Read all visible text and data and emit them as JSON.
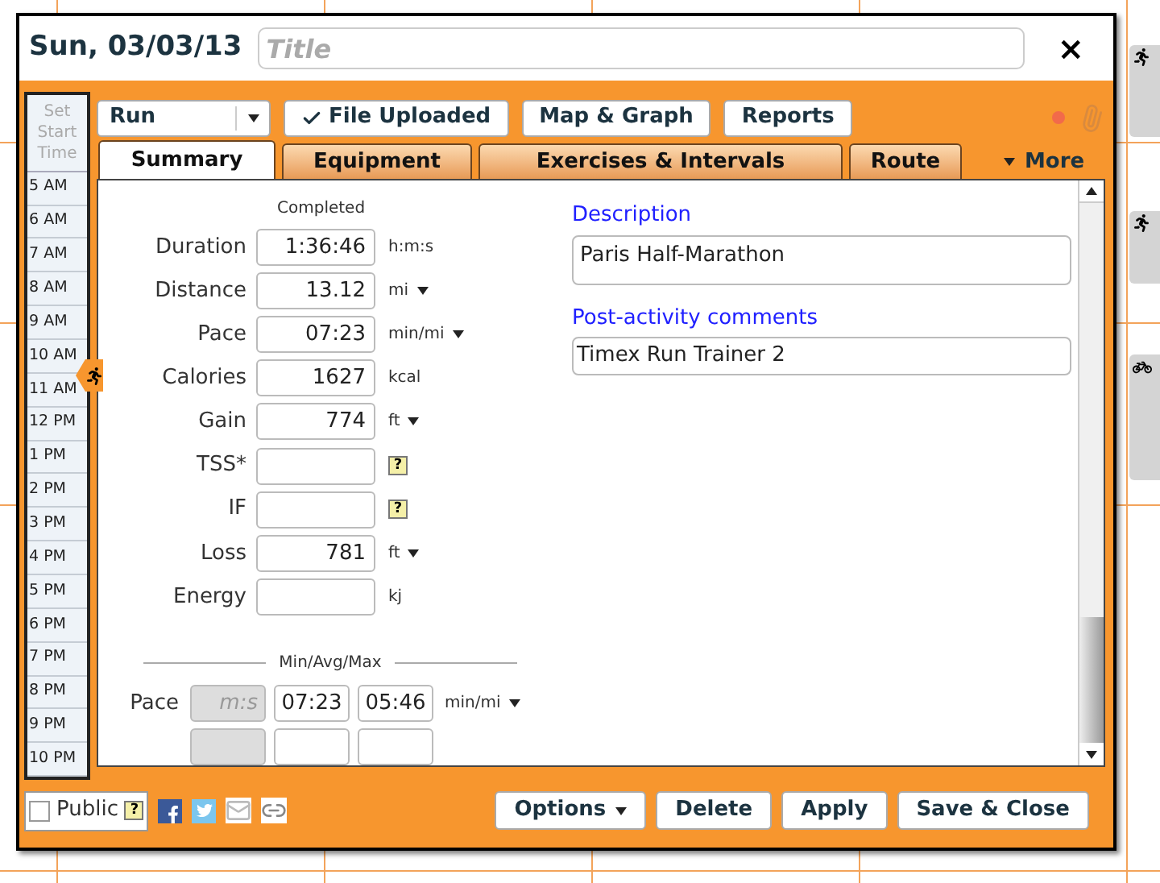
{
  "dialog": {
    "date": "Sun, 03/03/13",
    "title_placeholder": "Title",
    "close": "×"
  },
  "toolbar": {
    "sport": "Run",
    "buttons": [
      {
        "label": "File Uploaded",
        "checked": true
      },
      {
        "label": "Map & Graph",
        "checked": false
      },
      {
        "label": "Reports",
        "checked": false
      }
    ]
  },
  "tabs": [
    {
      "label": "Summary",
      "selected": true
    },
    {
      "label": "Equipment",
      "selected": false
    },
    {
      "label": "Exercises & Intervals",
      "selected": false
    },
    {
      "label": "Route",
      "selected": false
    }
  ],
  "more": "More",
  "time_column": {
    "header": "Set Start Time",
    "hours": [
      "5 AM",
      "6 AM",
      "7 AM",
      "8 AM",
      "9 AM",
      "10 AM",
      "11 AM",
      "12 PM",
      "1 PM",
      "2 PM",
      "3 PM",
      "4 PM",
      "5 PM",
      "6 PM",
      "7 PM",
      "8 PM",
      "9 PM",
      "10 PM"
    ]
  },
  "summary": {
    "status": "Completed",
    "fields": [
      {
        "label": "Duration",
        "value": "1:36:46",
        "unit": "h:m:s",
        "kind": "plain"
      },
      {
        "label": "Distance",
        "value": "13.12",
        "unit": "mi",
        "kind": "dropdown"
      },
      {
        "label": "Pace",
        "value": "07:23",
        "unit": "min/mi",
        "kind": "dropdown"
      },
      {
        "label": "Calories",
        "value": "1627",
        "unit": "kcal",
        "kind": "plain"
      },
      {
        "label": "Gain",
        "value": "774",
        "unit": "ft",
        "kind": "dropdown"
      },
      {
        "label": "TSS*",
        "help": "?",
        "kind": "help"
      },
      {
        "label": "IF",
        "help": "?",
        "kind": "help"
      },
      {
        "label": "Loss",
        "value": "781",
        "unit": "ft",
        "kind": "dropdown"
      },
      {
        "label": "Energy",
        "unit": "kj",
        "kind": "plain"
      }
    ]
  },
  "min_avg_max": {
    "heading": "Min/Avg/Max",
    "rows": [
      {
        "label": "Pace",
        "min_placeholder": "m:s",
        "avg": "07:23",
        "max": "05:46",
        "unit": "min/mi"
      }
    ]
  },
  "description": {
    "label": "Description",
    "value": "Paris Half-Marathon"
  },
  "comments": {
    "label": "Post-activity comments",
    "value": "Timex Run Trainer 2"
  },
  "footer": {
    "public": {
      "label": "Public",
      "checked": false,
      "help": "?"
    },
    "actions": [
      {
        "label": "Options",
        "kind": "menu"
      },
      {
        "label": "Delete",
        "kind": "plain"
      },
      {
        "label": "Apply",
        "kind": "plain"
      },
      {
        "label": "Save & Close",
        "kind": "plain"
      }
    ]
  }
}
